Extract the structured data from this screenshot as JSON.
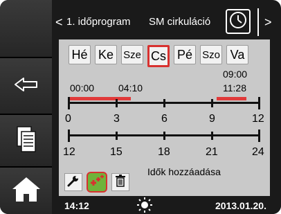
{
  "header": {
    "prev_glyph": "<",
    "program": "1. időprogram",
    "mode": "SM cirkuláció",
    "next_glyph": ">"
  },
  "days": [
    "Hé",
    "Ke",
    "Sze",
    "Cs",
    "Pé",
    "Szo",
    "Va"
  ],
  "selected_day": "Cs",
  "times": {
    "start1": "00:00",
    "end1": "04:10",
    "start2": "09:00",
    "end2": "11:28"
  },
  "scale_top": [
    "0",
    "3",
    "6",
    "9",
    "12"
  ],
  "scale_bottom": [
    "12",
    "15",
    "18",
    "21",
    "24"
  ],
  "add_times_label": "Idők hozzáadása",
  "footer": {
    "time": "14:12",
    "date": "2013.01.20."
  },
  "colors": {
    "accent_red": "#d8312f",
    "active_green": "#6fb33a",
    "panel_bg": "#c9c9c9"
  },
  "icons": {
    "sidebar": [
      "back-arrow-icon",
      "copy-icon",
      "home-icon"
    ],
    "header": [
      "clock-icon"
    ],
    "tools": [
      "wrench-icon",
      "add-times-icon",
      "trash-icon"
    ],
    "footer": [
      "sun-icon"
    ]
  }
}
